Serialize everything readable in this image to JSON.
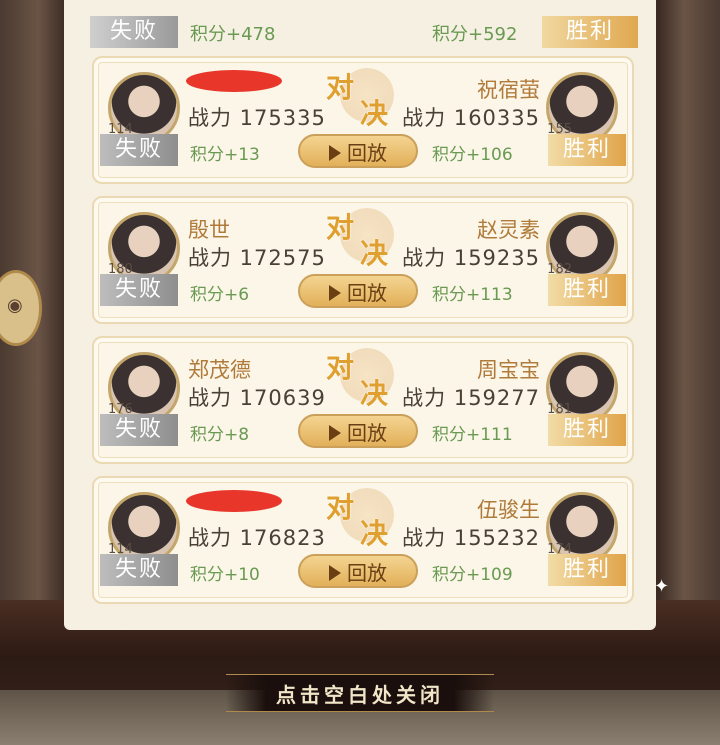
{
  "top_strip": {
    "left_result": "失败",
    "left_score": "积分+478",
    "right_score": "积分+592",
    "right_result": "胜利"
  },
  "vs_chars": [
    "对",
    "决"
  ],
  "replay_label": "回放",
  "matches": [
    {
      "left": {
        "name": "",
        "power": "战力 175335",
        "level": "114",
        "result": "失败",
        "score": "积分+13"
      },
      "right": {
        "name": "祝宿萤",
        "power": "战力 160335",
        "level": "155",
        "result": "胜利",
        "score": "积分+106"
      }
    },
    {
      "left": {
        "name": "殷世",
        "power": "战力 172575",
        "level": "180",
        "result": "失败",
        "score": "积分+6"
      },
      "right": {
        "name": "赵灵素",
        "power": "战力 159235",
        "level": "182",
        "result": "胜利",
        "score": "积分+113"
      }
    },
    {
      "left": {
        "name": "郑茂德",
        "power": "战力 170639",
        "level": "176",
        "result": "失败",
        "score": "积分+8"
      },
      "right": {
        "name": "周宝宝",
        "power": "战力 159277",
        "level": "181",
        "result": "胜利",
        "score": "积分+111"
      }
    },
    {
      "left": {
        "name": "",
        "power": "战力 176823",
        "level": "114",
        "result": "失败",
        "score": "积分+10"
      },
      "right": {
        "name": "伍骏生",
        "power": "战力 155232",
        "level": "174",
        "result": "胜利",
        "score": "积分+109"
      }
    }
  ],
  "footer": {
    "close_hint": "点击空白处关闭"
  },
  "colors": {
    "win": "#e0a44a",
    "lose": "#8e8e8e",
    "score_green": "#6a9a52",
    "name_gold": "#b07a3a"
  }
}
